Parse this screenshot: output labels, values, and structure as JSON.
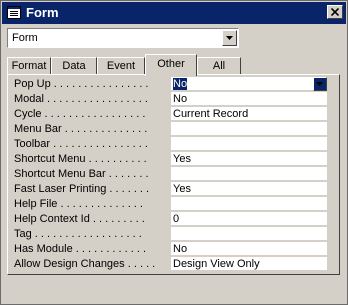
{
  "window": {
    "title": "Form"
  },
  "selector": {
    "value": "Form"
  },
  "tabs": [
    "Format",
    "Data",
    "Event",
    "Other",
    "All"
  ],
  "active_tab": "Other",
  "properties": [
    {
      "label": "Pop Up . . . . . . . . . . . . . . . .",
      "value": "No"
    },
    {
      "label": "Modal . . . . . . . . . . . . . . . . .",
      "value": "No"
    },
    {
      "label": "Cycle . . . . . . . . . . . . . . . . .",
      "value": "Current Record"
    },
    {
      "label": "Menu Bar . . . . . . . . . . . . . .",
      "value": ""
    },
    {
      "label": "Toolbar . . . . . . . . . . . . . . . .",
      "value": ""
    },
    {
      "label": "Shortcut Menu . . . . . . . . . .",
      "value": "Yes"
    },
    {
      "label": "Shortcut Menu Bar . . . . . . .",
      "value": ""
    },
    {
      "label": "Fast Laser Printing . . . . . . .",
      "value": "Yes"
    },
    {
      "label": "Help File . . . . . . . . . . . . . .",
      "value": ""
    },
    {
      "label": "Help Context Id . . . . . . . . .",
      "value": "0"
    },
    {
      "label": "Tag . . . . . . . . . . . . . . . . . .",
      "value": ""
    },
    {
      "label": "Has Module . . . . . . . . . . . .",
      "value": "No"
    },
    {
      "label": "Allow Design Changes . . . . .",
      "value": "Design View Only"
    }
  ],
  "colors": {
    "titlebar": "#0a246a",
    "face": "#d4d0c8",
    "selection": "#0a246a"
  }
}
